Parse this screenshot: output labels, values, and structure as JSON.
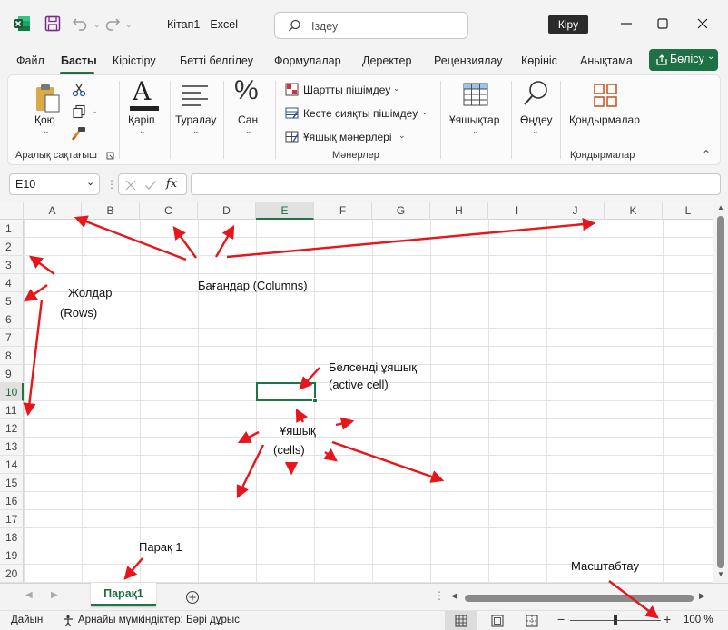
{
  "window": {
    "title": "Кітап1  -  Excel",
    "search_placeholder": "Іздеу",
    "signin_label": "Кіру"
  },
  "tabs": [
    {
      "label": "Файл"
    },
    {
      "label": "Басты"
    },
    {
      "label": "Кірістіру"
    },
    {
      "label": "Бетті белгілеу"
    },
    {
      "label": "Формулалар"
    },
    {
      "label": "Деректер"
    },
    {
      "label": "Рецензиялау"
    },
    {
      "label": "Көрініс"
    },
    {
      "label": "Анықтама"
    }
  ],
  "share_label": "Бөлісу",
  "ribbon": {
    "paste_label": "Қою",
    "clipboard_group": "Аралық сақтағыш",
    "font_label": "Қаріп",
    "alignment_label": "Туралау",
    "number_label": "Сан",
    "cond_format_label": "Шартты пішімдеу",
    "table_format_label": "Кесте сияқты пішімдеу",
    "cell_styles_label": "Ұяшық мәнерлері",
    "styles_group": "Мәнерлер",
    "cells_label": "Ұяшықтар",
    "editing_label": "Өңдеу",
    "addins_label": "Қондырмалар",
    "addins_group": "Қондырмалар"
  },
  "formula_bar": {
    "name_box": "E10",
    "fx_label": "fx",
    "value": ""
  },
  "grid": {
    "columns": [
      "A",
      "B",
      "C",
      "D",
      "E",
      "F",
      "G",
      "H",
      "I",
      "J",
      "K",
      "L"
    ],
    "rows": [
      "1",
      "2",
      "3",
      "4",
      "5",
      "6",
      "7",
      "8",
      "9",
      "10",
      "11",
      "12",
      "13",
      "14",
      "15",
      "16",
      "17",
      "18",
      "19",
      "20"
    ],
    "selected_column": "E",
    "selected_row": "10"
  },
  "sheets": [
    {
      "name": "Парақ1",
      "active": true
    }
  ],
  "status": {
    "ready": "Дайын",
    "accessibility": "Арнайы мүмкіндіктер: Бәрі дұрыс",
    "zoom": "100 %",
    "zoom_fraction": 0.5
  },
  "annotations": {
    "rows_line1": "Жолдар",
    "rows_line2": "(Rows)",
    "columns": "Бағандар (Columns)",
    "active_line1": "Белсенді ұяшық",
    "active_line2": "(active cell)",
    "cells_line1": "Ұяшық",
    "cells_line2": "(cells)",
    "sheet": "Парақ 1",
    "zoom": "Масштабтау"
  },
  "colors": {
    "excel_green": "#217346",
    "share_green": "#1e7145",
    "annotation_arrow": "#e8161b"
  }
}
